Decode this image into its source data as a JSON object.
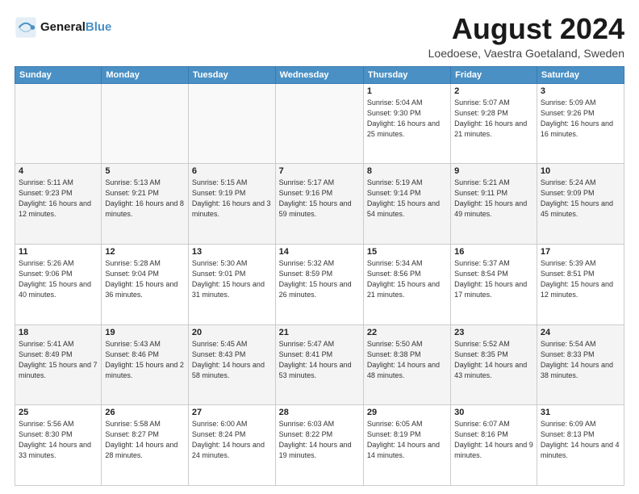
{
  "logo": {
    "line1": "General",
    "line2": "Blue"
  },
  "title": "August 2024",
  "location": "Loedoese, Vaestra Goetaland, Sweden",
  "days_of_week": [
    "Sunday",
    "Monday",
    "Tuesday",
    "Wednesday",
    "Thursday",
    "Friday",
    "Saturday"
  ],
  "weeks": [
    [
      {
        "day": "",
        "info": ""
      },
      {
        "day": "",
        "info": ""
      },
      {
        "day": "",
        "info": ""
      },
      {
        "day": "",
        "info": ""
      },
      {
        "day": "1",
        "info": "Sunrise: 5:04 AM\nSunset: 9:30 PM\nDaylight: 16 hours\nand 25 minutes."
      },
      {
        "day": "2",
        "info": "Sunrise: 5:07 AM\nSunset: 9:28 PM\nDaylight: 16 hours\nand 21 minutes."
      },
      {
        "day": "3",
        "info": "Sunrise: 5:09 AM\nSunset: 9:26 PM\nDaylight: 16 hours\nand 16 minutes."
      }
    ],
    [
      {
        "day": "4",
        "info": "Sunrise: 5:11 AM\nSunset: 9:23 PM\nDaylight: 16 hours\nand 12 minutes."
      },
      {
        "day": "5",
        "info": "Sunrise: 5:13 AM\nSunset: 9:21 PM\nDaylight: 16 hours\nand 8 minutes."
      },
      {
        "day": "6",
        "info": "Sunrise: 5:15 AM\nSunset: 9:19 PM\nDaylight: 16 hours\nand 3 minutes."
      },
      {
        "day": "7",
        "info": "Sunrise: 5:17 AM\nSunset: 9:16 PM\nDaylight: 15 hours\nand 59 minutes."
      },
      {
        "day": "8",
        "info": "Sunrise: 5:19 AM\nSunset: 9:14 PM\nDaylight: 15 hours\nand 54 minutes."
      },
      {
        "day": "9",
        "info": "Sunrise: 5:21 AM\nSunset: 9:11 PM\nDaylight: 15 hours\nand 49 minutes."
      },
      {
        "day": "10",
        "info": "Sunrise: 5:24 AM\nSunset: 9:09 PM\nDaylight: 15 hours\nand 45 minutes."
      }
    ],
    [
      {
        "day": "11",
        "info": "Sunrise: 5:26 AM\nSunset: 9:06 PM\nDaylight: 15 hours\nand 40 minutes."
      },
      {
        "day": "12",
        "info": "Sunrise: 5:28 AM\nSunset: 9:04 PM\nDaylight: 15 hours\nand 36 minutes."
      },
      {
        "day": "13",
        "info": "Sunrise: 5:30 AM\nSunset: 9:01 PM\nDaylight: 15 hours\nand 31 minutes."
      },
      {
        "day": "14",
        "info": "Sunrise: 5:32 AM\nSunset: 8:59 PM\nDaylight: 15 hours\nand 26 minutes."
      },
      {
        "day": "15",
        "info": "Sunrise: 5:34 AM\nSunset: 8:56 PM\nDaylight: 15 hours\nand 21 minutes."
      },
      {
        "day": "16",
        "info": "Sunrise: 5:37 AM\nSunset: 8:54 PM\nDaylight: 15 hours\nand 17 minutes."
      },
      {
        "day": "17",
        "info": "Sunrise: 5:39 AM\nSunset: 8:51 PM\nDaylight: 15 hours\nand 12 minutes."
      }
    ],
    [
      {
        "day": "18",
        "info": "Sunrise: 5:41 AM\nSunset: 8:49 PM\nDaylight: 15 hours\nand 7 minutes."
      },
      {
        "day": "19",
        "info": "Sunrise: 5:43 AM\nSunset: 8:46 PM\nDaylight: 15 hours\nand 2 minutes."
      },
      {
        "day": "20",
        "info": "Sunrise: 5:45 AM\nSunset: 8:43 PM\nDaylight: 14 hours\nand 58 minutes."
      },
      {
        "day": "21",
        "info": "Sunrise: 5:47 AM\nSunset: 8:41 PM\nDaylight: 14 hours\nand 53 minutes."
      },
      {
        "day": "22",
        "info": "Sunrise: 5:50 AM\nSunset: 8:38 PM\nDaylight: 14 hours\nand 48 minutes."
      },
      {
        "day": "23",
        "info": "Sunrise: 5:52 AM\nSunset: 8:35 PM\nDaylight: 14 hours\nand 43 minutes."
      },
      {
        "day": "24",
        "info": "Sunrise: 5:54 AM\nSunset: 8:33 PM\nDaylight: 14 hours\nand 38 minutes."
      }
    ],
    [
      {
        "day": "25",
        "info": "Sunrise: 5:56 AM\nSunset: 8:30 PM\nDaylight: 14 hours\nand 33 minutes."
      },
      {
        "day": "26",
        "info": "Sunrise: 5:58 AM\nSunset: 8:27 PM\nDaylight: 14 hours\nand 28 minutes."
      },
      {
        "day": "27",
        "info": "Sunrise: 6:00 AM\nSunset: 8:24 PM\nDaylight: 14 hours\nand 24 minutes."
      },
      {
        "day": "28",
        "info": "Sunrise: 6:03 AM\nSunset: 8:22 PM\nDaylight: 14 hours\nand 19 minutes."
      },
      {
        "day": "29",
        "info": "Sunrise: 6:05 AM\nSunset: 8:19 PM\nDaylight: 14 hours\nand 14 minutes."
      },
      {
        "day": "30",
        "info": "Sunrise: 6:07 AM\nSunset: 8:16 PM\nDaylight: 14 hours\nand 9 minutes."
      },
      {
        "day": "31",
        "info": "Sunrise: 6:09 AM\nSunset: 8:13 PM\nDaylight: 14 hours\nand 4 minutes."
      }
    ]
  ]
}
